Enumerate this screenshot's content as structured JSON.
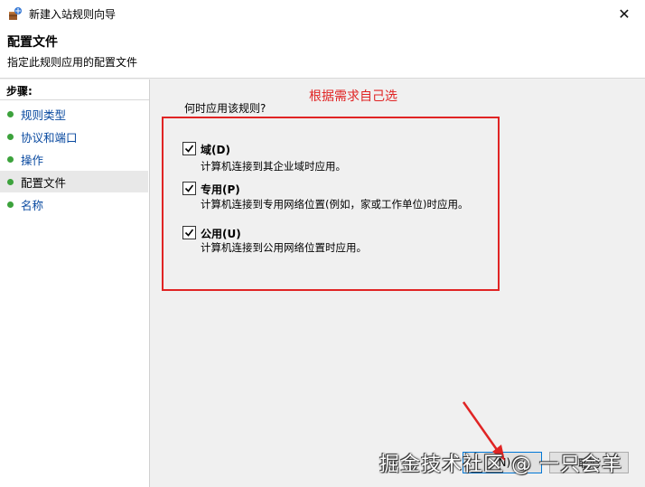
{
  "window": {
    "title": "新建入站规则向导"
  },
  "header": {
    "title": "配置文件",
    "subtitle": "指定此规则应用的配置文件"
  },
  "sidebar": {
    "steps_label": "步骤:",
    "items": [
      {
        "label": "规则类型"
      },
      {
        "label": "协议和端口"
      },
      {
        "label": "操作"
      },
      {
        "label": "配置文件",
        "active": true
      },
      {
        "label": "名称"
      }
    ]
  },
  "main": {
    "annotation": "根据需求自己选",
    "question": "何时应用该规则?",
    "options": [
      {
        "title": "域(D)",
        "desc": "计算机连接到其企业域时应用。",
        "checked": true
      },
      {
        "title": "专用(P)",
        "desc": "计算机连接到专用网络位置(例如，家或工作单位)时应用。",
        "checked": true
      },
      {
        "title": "公用(U)",
        "desc": "计算机连接到公用网络位置时应用。",
        "checked": true
      }
    ]
  },
  "buttons": {
    "next_label": "(N)",
    "cancel_label": "取消"
  },
  "watermark": "掘金技术社区 @ 一只会羊",
  "colors": {
    "accent_red": "#e02424",
    "step_dot": "#3ca23c",
    "link_blue": "#0a4aa0"
  }
}
